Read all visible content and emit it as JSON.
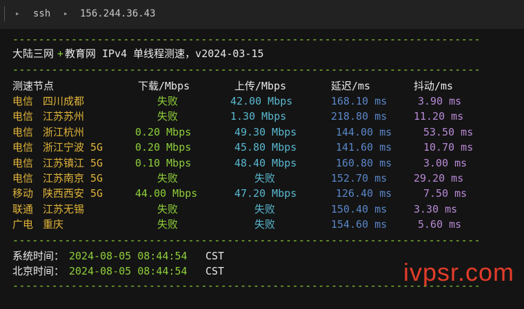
{
  "tab": {
    "prefix": "▸",
    "segment1": "ssh",
    "separator": "▸",
    "segment2": "156.244.36.43"
  },
  "dashes": "------------------------------------------------------------------------",
  "title": {
    "part1": "大陆三网",
    "plus": "+",
    "part2": "教育网 IPv4 单线程测速，v2024-03-15"
  },
  "headers": {
    "node": "测速节点",
    "down": "下载/Mbps",
    "up": "上传/Mbps",
    "latency": "延迟/ms",
    "jitter": "抖动/ms"
  },
  "rows": [
    {
      "isp": "电信",
      "node": "四川成都",
      "down": "失败",
      "up": "42.00 Mbps",
      "latency": "168.10 ms",
      "jitter": "3.90 ms"
    },
    {
      "isp": "电信",
      "node": "江苏苏州",
      "down": "失败",
      "up": "1.30 Mbps",
      "latency": "218.80 ms",
      "jitter": "11.20 ms"
    },
    {
      "isp": "电信",
      "node": "浙江杭州",
      "down": "0.20 Mbps",
      "up": "49.30 Mbps",
      "latency": "144.00 ms",
      "jitter": "53.50 ms"
    },
    {
      "isp": "电信",
      "node": "浙江宁波 5G",
      "down": "0.20 Mbps",
      "up": "45.80 Mbps",
      "latency": "141.60 ms",
      "jitter": "10.70 ms"
    },
    {
      "isp": "电信",
      "node": "江苏镇江 5G",
      "down": "0.10 Mbps",
      "up": "48.40 Mbps",
      "latency": "160.80 ms",
      "jitter": "3.00 ms"
    },
    {
      "isp": "电信",
      "node": "江苏南京 5G",
      "down": "失败",
      "up": "失败",
      "latency": "152.70 ms",
      "jitter": "29.20 ms"
    },
    {
      "isp": "移动",
      "node": "陕西西安 5G",
      "down": "44.00 Mbps",
      "up": "47.20 Mbps",
      "latency": "126.40 ms",
      "jitter": "7.50 ms"
    },
    {
      "isp": "联通",
      "node": "江苏无锡",
      "down": "失败",
      "up": "失败",
      "latency": "150.40 ms",
      "jitter": "3.30 ms"
    },
    {
      "isp": "广电",
      "node": "重庆",
      "down": "失败",
      "up": "失败",
      "latency": "154.60 ms",
      "jitter": "5.60 ms"
    }
  ],
  "footer": {
    "sys_label": "系统时间：",
    "sys_time": "2024-08-05 08:44:54",
    "sys_tz": "CST",
    "bj_label": "北京时间：",
    "bj_time": "2024-08-05 08:44:54",
    "bj_tz": "CST"
  },
  "watermark": "ivpsr.com",
  "colors": {
    "dash": "#8fcf3a",
    "node": "#e0b43a",
    "down": "#8fcf3a",
    "up": "#59b8d0",
    "latency": "#5a86c8",
    "jitter": "#b88ad6"
  }
}
